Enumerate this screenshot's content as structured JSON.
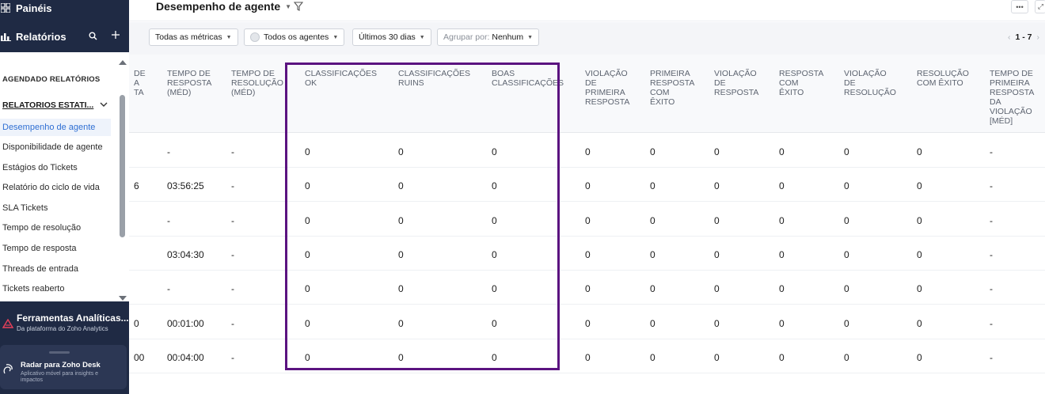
{
  "sidebar": {
    "paineis_label": "Painéis",
    "relatorios_label": "Relatórios",
    "section_agendado": "AGENDADO RELATÓRIOS",
    "group_label": "RELATORIOS ESTATI...",
    "items": [
      {
        "label": "Desempenho de agente",
        "active": true
      },
      {
        "label": "Disponibilidade de agente"
      },
      {
        "label": "Estágios do Tickets"
      },
      {
        "label": "Relatório do ciclo de vida"
      },
      {
        "label": "SLA Tickets"
      },
      {
        "label": "Tempo de resolução"
      },
      {
        "label": "Tempo de resposta"
      },
      {
        "label": "Threads de entrada"
      },
      {
        "label": "Tickets reaberto"
      }
    ],
    "tools_title": "Ferramentas Analíticas...",
    "tools_sub": "Da plataforma do Zoho Analytics",
    "radar_title": "Radar para Zoho Desk",
    "radar_sub": "Aplicativo móvel para insights e impactos"
  },
  "header": {
    "title": "Desempenho de agente",
    "more_label": "•••",
    "expand_label": "⤢"
  },
  "toolbar": {
    "metrics": "Todas as métricas",
    "agents": "Todos os agentes",
    "period": "Últimos 30 dias",
    "group_prefix": "Agrupar por:",
    "group_value": "Nenhum",
    "pager": "1 - 7"
  },
  "table": {
    "columns": [
      {
        "key": "c0",
        "label": "DE\nA\nTA"
      },
      {
        "key": "c1",
        "label": "TEMPO DE\nRESPOSTA\n(MÉD)"
      },
      {
        "key": "c2",
        "label": "TEMPO DE\nRESOLUÇÃO\n(MÉD)"
      },
      {
        "key": "c3",
        "label": "CLASSIFICAÇÕES\nOK"
      },
      {
        "key": "c4",
        "label": "CLASSIFICAÇÕES\nRUINS"
      },
      {
        "key": "c5",
        "label": "BOAS\nCLASSIFICAÇÕES"
      },
      {
        "key": "c6",
        "label": "VIOLAÇÃO\nDE\nPRIMEIRA\nRESPOSTA"
      },
      {
        "key": "c7",
        "label": "PRIMEIRA\nRESPOSTA\nCOM\nÊXITO"
      },
      {
        "key": "c8",
        "label": "VIOLAÇÃO\nDE\nRESPOSTA"
      },
      {
        "key": "c9",
        "label": "RESPOSTA\nCOM\nÊXITO"
      },
      {
        "key": "c10",
        "label": "VIOLAÇÃO\nDE\nRESOLUÇÃO"
      },
      {
        "key": "c11",
        "label": "RESOLUÇÃO\nCOM ÊXITO"
      },
      {
        "key": "c12",
        "label": "TEMPO DE\nPRIMEIRA\nRESPOSTA\nDA\nVIOLAÇÃO\n[MÉD]"
      }
    ],
    "rows": [
      [
        "",
        "-",
        "-",
        "0",
        "0",
        "0",
        "0",
        "0",
        "0",
        "0",
        "0",
        "0",
        "-"
      ],
      [
        "6",
        "03:56:25",
        "-",
        "0",
        "0",
        "0",
        "0",
        "0",
        "0",
        "0",
        "0",
        "0",
        "-"
      ],
      [
        "",
        "-",
        "-",
        "0",
        "0",
        "0",
        "0",
        "0",
        "0",
        "0",
        "0",
        "0",
        "-"
      ],
      [
        "",
        "03:04:30",
        "-",
        "0",
        "0",
        "0",
        "0",
        "0",
        "0",
        "0",
        "0",
        "0",
        "-"
      ],
      [
        "",
        "-",
        "-",
        "0",
        "0",
        "0",
        "0",
        "0",
        "0",
        "0",
        "0",
        "0",
        "-"
      ],
      [
        "0",
        "00:01:00",
        "-",
        "0",
        "0",
        "0",
        "0",
        "0",
        "0",
        "0",
        "0",
        "0",
        "-"
      ],
      [
        "00",
        "00:04:00",
        "-",
        "0",
        "0",
        "0",
        "0",
        "0",
        "0",
        "0",
        "0",
        "0",
        "-"
      ]
    ]
  }
}
